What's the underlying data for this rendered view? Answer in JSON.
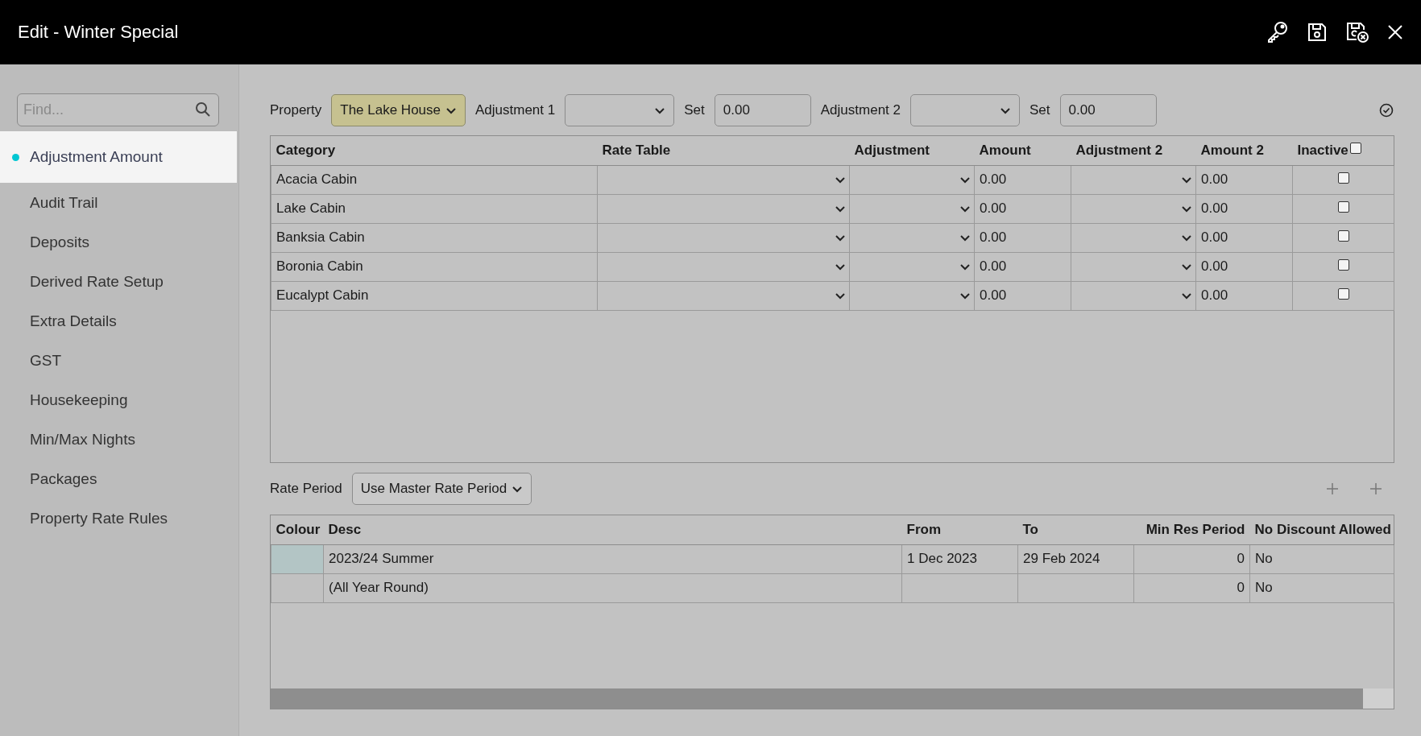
{
  "window": {
    "title": "Edit - Winter Special"
  },
  "sidebar": {
    "search": {
      "placeholder": "Find..."
    },
    "items": [
      {
        "label": "Adjustment Amount",
        "selected": true
      },
      {
        "label": "Audit Trail",
        "selected": false
      },
      {
        "label": "Deposits",
        "selected": false
      },
      {
        "label": "Derived Rate Setup",
        "selected": false
      },
      {
        "label": "Extra Details",
        "selected": false
      },
      {
        "label": "GST",
        "selected": false
      },
      {
        "label": "Housekeeping",
        "selected": false
      },
      {
        "label": "Min/Max Nights",
        "selected": false
      },
      {
        "label": "Packages",
        "selected": false
      },
      {
        "label": "Property Rate Rules",
        "selected": false
      }
    ]
  },
  "toolbar": {
    "property": {
      "label": "Property",
      "value": "The Lake House"
    },
    "adjustment_1": {
      "label": "Adjustment 1",
      "set_label": "Set",
      "set_value": "0.00"
    },
    "adjustment_2": {
      "label": "Adjustment 2",
      "set_label": "Set",
      "set_value": "0.00"
    }
  },
  "category_table": {
    "columns": [
      "Category",
      "Rate Table",
      "Adjustment",
      "Amount",
      "Adjustment 2",
      "Amount 2",
      "Inactive"
    ],
    "inactive_all": false,
    "rows": [
      {
        "category": "Acacia Cabin",
        "amount": "0.00",
        "amount_2": "0.00",
        "inactive": false
      },
      {
        "category": "Lake Cabin",
        "amount": "0.00",
        "amount_2": "0.00",
        "inactive": false
      },
      {
        "category": "Banksia Cabin",
        "amount": "0.00",
        "amount_2": "0.00",
        "inactive": false
      },
      {
        "category": "Boronia Cabin",
        "amount": "0.00",
        "amount_2": "0.00",
        "inactive": false
      },
      {
        "category": "Eucalypt Cabin",
        "amount": "0.00",
        "amount_2": "0.00",
        "inactive": false
      }
    ]
  },
  "rate_period": {
    "label": "Rate Period",
    "value": "Use Master Rate Period"
  },
  "period_table": {
    "columns": [
      "Colour",
      "Desc",
      "From",
      "To",
      "Min Res Period",
      "No Discount Allowed"
    ],
    "rows": [
      {
        "color": "#b3c5c5",
        "desc": "2023/24 Summer",
        "from": "1 Dec 2023",
        "to": "29 Feb 2024",
        "min_res_period": "0",
        "no_discount_allowed": "No"
      },
      {
        "color": "#c1c1c1",
        "desc": "(All Year Round)",
        "min_res_period": "0",
        "no_discount_allowed": "No"
      }
    ]
  }
}
